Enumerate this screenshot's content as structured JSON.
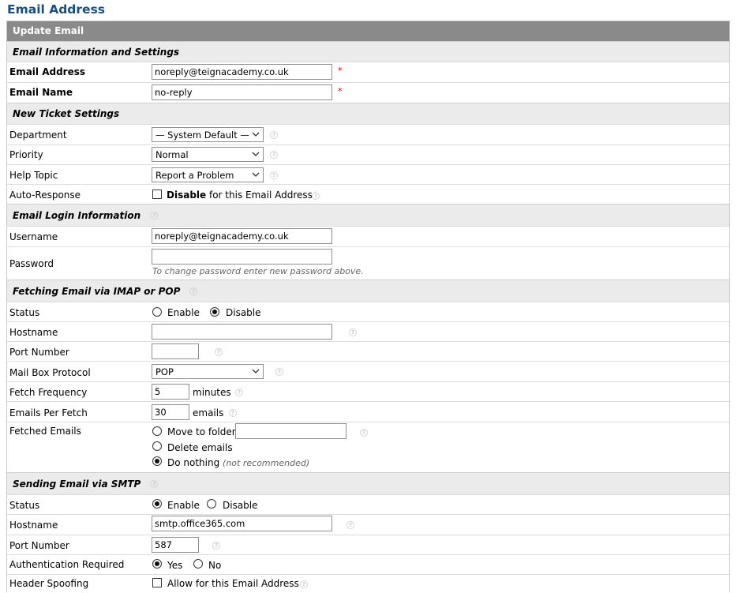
{
  "page_title": "Email Address",
  "form_title": "Update Email",
  "sections": {
    "info": "Email Information and Settings",
    "ticket": "New Ticket Settings",
    "login": "Email Login Information",
    "fetch": "Fetching Email via IMAP or POP",
    "smtp": "Sending Email via SMTP"
  },
  "info": {
    "email_label": "Email Address",
    "email_value": "noreply@teignacademy.co.uk",
    "name_label": "Email Name",
    "name_value": "no-reply",
    "required_mark": "*"
  },
  "ticket": {
    "department_label": "Department",
    "department_value": "— System Default —",
    "priority_label": "Priority",
    "priority_value": "Normal",
    "helptopic_label": "Help Topic",
    "helptopic_value": "Report a Problem",
    "autoresponse_label": "Auto-Response",
    "autoresponse_bold": "Disable",
    "autoresponse_rest": "for this Email Address",
    "autoresponse_checked": false
  },
  "login": {
    "username_label": "Username",
    "username_value": "noreply@teignacademy.co.uk",
    "password_label": "Password",
    "password_value": "",
    "password_hint": "To change password enter new password above."
  },
  "fetch": {
    "status_label": "Status",
    "status_enable": "Enable",
    "status_disable": "Disable",
    "status_selected": "disable",
    "hostname_label": "Hostname",
    "hostname_value": "",
    "port_label": "Port Number",
    "port_value": "",
    "protocol_label": "Mail Box Protocol",
    "protocol_value": "POP",
    "frequency_label": "Fetch Frequency",
    "frequency_value": "5",
    "frequency_unit": "minutes",
    "perfetch_label": "Emails Per Fetch",
    "perfetch_value": "30",
    "perfetch_unit": "emails",
    "fetched_label": "Fetched Emails",
    "opt_move": "Move to folder:",
    "opt_move_folder": "",
    "opt_delete": "Delete emails",
    "opt_nothing": "Do nothing",
    "opt_nothing_note": "(not recommended)",
    "fetched_selected": "nothing"
  },
  "smtp": {
    "status_label": "Status",
    "status_enable": "Enable",
    "status_disable": "Disable",
    "status_selected": "enable",
    "hostname_label": "Hostname",
    "hostname_value": "smtp.office365.com",
    "port_label": "Port Number",
    "port_value": "587",
    "auth_label": "Authentication Required",
    "auth_yes": "Yes",
    "auth_no": "No",
    "auth_selected": "yes",
    "spoof_label": "Header Spoofing",
    "spoof_text": "Allow for this Email Address",
    "spoof_checked": false
  }
}
